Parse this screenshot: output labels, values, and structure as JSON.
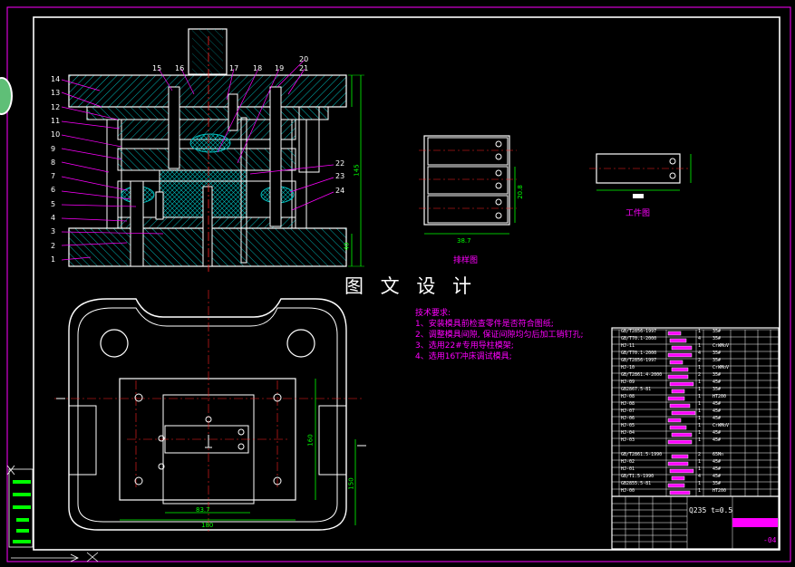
{
  "drawing": {
    "watermark": "图 文 设 计",
    "layout_label": "排样图",
    "workpiece_label": "工件图",
    "material_spec": "Q235  t=0.5",
    "sheet_no": "-04",
    "notes_title": "技术要求:",
    "notes": [
      "1、安装模具前检查零件是否符合图纸;",
      "2、调整模具间隙, 保证间隙均匀后加工销钉孔;",
      "3、选用22#专用导柱模架;",
      "4、选用16T冲床调试模具;"
    ],
    "part_numbers_left": [
      "14",
      "13",
      "12",
      "11",
      "10",
      "9",
      "8",
      "7",
      "6",
      "5",
      "4",
      "3",
      "2",
      "1"
    ],
    "part_numbers_top": [
      "15",
      "16",
      "17",
      "18",
      "19",
      "20",
      "21"
    ],
    "part_numbers_right": [
      "22",
      "23",
      "24"
    ],
    "dims": {
      "layout_width": "38.7",
      "layout_pitch": "20.8",
      "plan_width": "180",
      "plan_inner": "83.7",
      "plan_height": "160",
      "plan_right": "150",
      "height_total": "145",
      "height_small": "40"
    }
  },
  "colors": {
    "outline": "#ffffff",
    "hatch": "#00d8d8",
    "dimension": "#00ff00",
    "leader": "#ff00ff",
    "centerline": "#ff2222",
    "frame": "#ff00ff",
    "highlight": "#ff00ff",
    "yellow": "#ffff00"
  },
  "bom_rows": [
    {
      "code": "GB/T2856-1997",
      "qty": "1",
      "mat": "35#"
    },
    {
      "code": "GB/T70.1-2000",
      "qty": "4",
      "mat": "35#"
    },
    {
      "code": "HJ-11",
      "qty": "1",
      "mat": "CrWMoV"
    },
    {
      "code": "GB/T70.1-2000",
      "qty": "4",
      "mat": "35#"
    },
    {
      "code": "GB/T2856-1997",
      "qty": "2",
      "mat": "35#"
    },
    {
      "code": "HJ-10",
      "qty": "1",
      "mat": "CrWMoV"
    },
    {
      "code": "GB/T2861.4-2000",
      "qty": "2",
      "mat": "35#"
    },
    {
      "code": "HJ-09",
      "qty": "1",
      "mat": "45#"
    },
    {
      "code": "GB2867.5-81",
      "qty": "1",
      "mat": "35#"
    },
    {
      "code": "HJ-08",
      "qty": "1",
      "mat": "HT200"
    },
    {
      "code": "HJ-08",
      "qty": "1",
      "mat": "45#"
    },
    {
      "code": "HJ-07",
      "qty": "1",
      "mat": "45#"
    },
    {
      "code": "HJ-06",
      "qty": "1",
      "mat": "45#"
    },
    {
      "code": "HJ-05",
      "qty": "1",
      "mat": "CrWMoV"
    },
    {
      "code": "HJ-04",
      "qty": "1",
      "mat": "45#"
    },
    {
      "code": "HJ-03",
      "qty": "1",
      "mat": "45#"
    },
    {
      "code": "",
      "qty": "",
      "mat": ""
    },
    {
      "code": "GB/T2861.5-1990",
      "qty": "2",
      "mat": "65Mn"
    },
    {
      "code": "HJ-02",
      "qty": "1",
      "mat": "45#"
    },
    {
      "code": "HJ-01",
      "qty": "1",
      "mat": "45#"
    },
    {
      "code": "GB/T1.5-1990",
      "qty": "4",
      "mat": "45#"
    },
    {
      "code": "GB2855.5-81",
      "qty": "1",
      "mat": "35#"
    },
    {
      "code": "HJ-00",
      "qty": "1",
      "mat": "HT200"
    }
  ]
}
